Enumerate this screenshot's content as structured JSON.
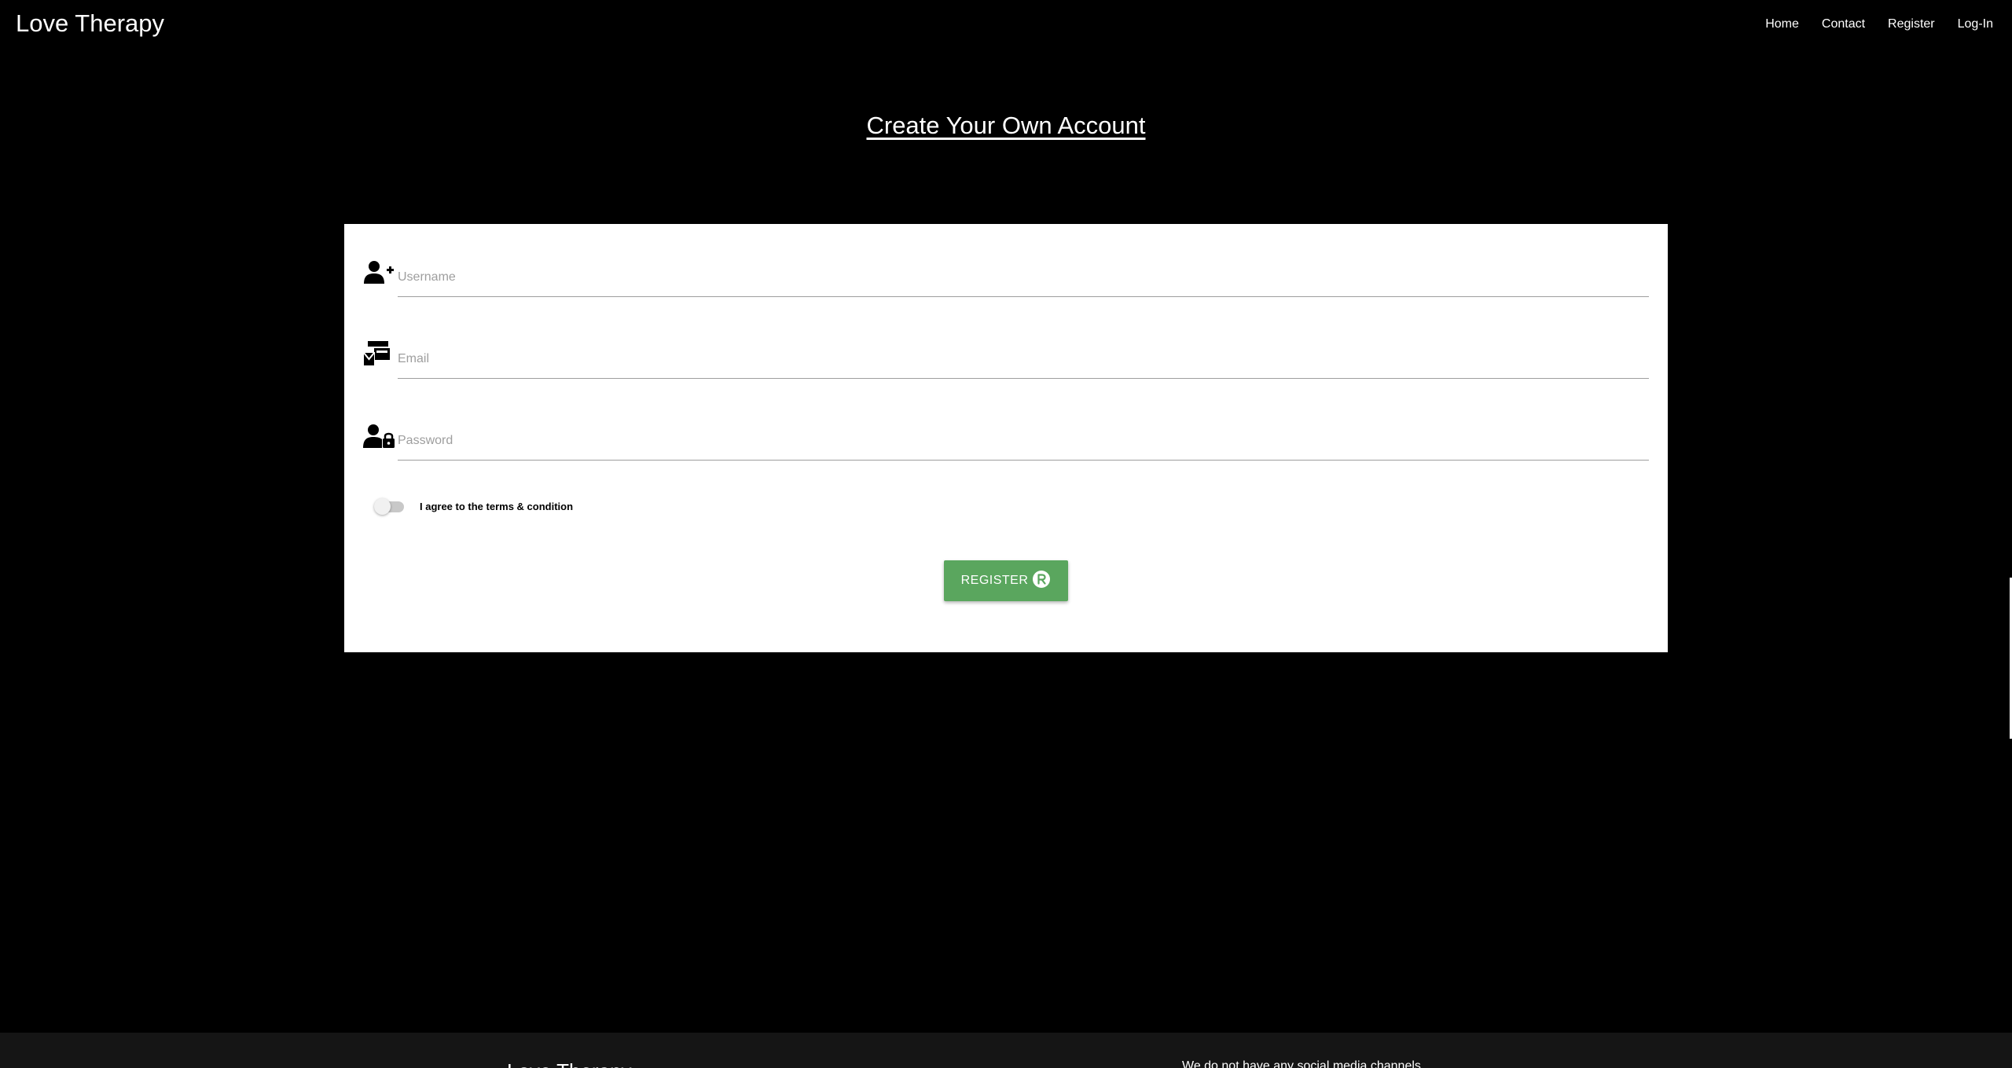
{
  "app": {
    "brand": "Love Therapy"
  },
  "nav": {
    "items": [
      {
        "label": "Home"
      },
      {
        "label": "Contact"
      },
      {
        "label": "Register"
      },
      {
        "label": "Log-In"
      }
    ]
  },
  "page": {
    "title": "Create Your Own Account"
  },
  "form": {
    "username": {
      "placeholder": "Username",
      "value": "",
      "icon": "user-plus-icon"
    },
    "email": {
      "placeholder": "Email",
      "value": "",
      "icon": "mail-bulk-icon"
    },
    "password": {
      "placeholder": "Password",
      "value": "",
      "icon": "user-lock-icon"
    },
    "terms": {
      "label": "I agree to the terms & condition",
      "checked": false
    },
    "submit": {
      "label": "REGISTER",
      "icon": "registered-icon",
      "color": "#5aa65e"
    }
  },
  "footer": {
    "brand": "Love Therapy",
    "note": "We do not have any social media channels"
  }
}
